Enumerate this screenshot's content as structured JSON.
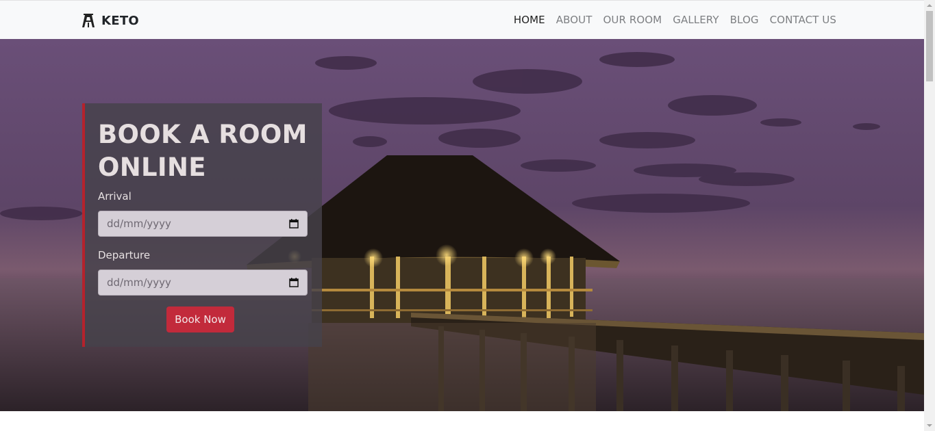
{
  "brand": {
    "name": "KETO",
    "icon": "keto-logo-icon"
  },
  "nav": {
    "items": [
      {
        "label": "HOME",
        "active": true
      },
      {
        "label": "ABOUT"
      },
      {
        "label": "OUR ROOM"
      },
      {
        "label": "GALLERY"
      },
      {
        "label": "BLOG"
      },
      {
        "label": "CONTACT US"
      }
    ]
  },
  "booking": {
    "title": "BOOK A ROOM ONLINE",
    "arrival_label": "Arrival",
    "arrival_value": "dd/mm/yyyy",
    "departure_label": "Departure",
    "departure_value": "dd/mm/yyyy",
    "button_label": "Book Now"
  },
  "colors": {
    "accent": "#c22a3b",
    "navbar_bg": "#f8f9fa",
    "nav_active": "#1f1f1f",
    "nav_inactive": "#7d7f82"
  }
}
